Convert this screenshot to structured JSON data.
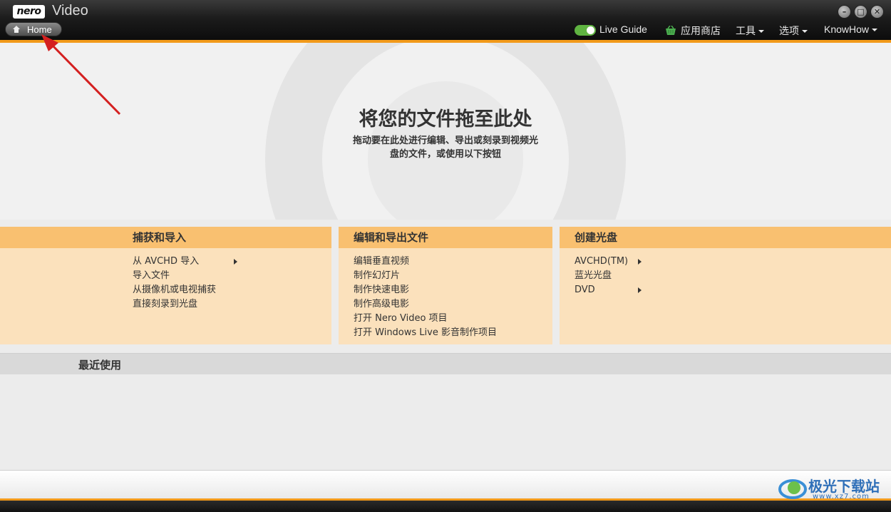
{
  "titlebar": {
    "logo": "nero",
    "app_title": "Video",
    "home_label": "Home",
    "window_controls": [
      "minimize-icon",
      "maximize-icon",
      "close-icon"
    ]
  },
  "menu": {
    "live_guide": "Live Guide",
    "app_store": "应用商店",
    "tools": "工具",
    "options": "选项",
    "knowhow": "KnowHow"
  },
  "drop": {
    "title": "将您的文件拖至此处",
    "subtitle": "拖动要在此处进行编辑、导出或刻录到视频光盘的文件，或使用以下按钮"
  },
  "panels": [
    {
      "title": "捕获和导入",
      "items": [
        "从 AVCHD 导入",
        "导入文件",
        "从摄像机或电视捕获",
        "直接刻录到光盘"
      ]
    },
    {
      "title": "编辑和导出文件",
      "items": [
        "编辑垂直视频",
        "制作幻灯片",
        "制作快速电影",
        "制作高级电影",
        "打开 Nero Video 项目",
        "打开 Windows Live 影音制作项目"
      ]
    },
    {
      "title": "创建光盘",
      "items": [
        "AVCHD(TM)",
        "蓝光光盘",
        "DVD"
      ]
    }
  ],
  "recent": {
    "title": "最近使用"
  },
  "watermark": {
    "text": "极光下载站",
    "url": "www.xz7.com"
  },
  "colors": {
    "accent": "#f29a1a",
    "panel_header": "#f9c070",
    "panel_body": "#fbe1bc"
  }
}
